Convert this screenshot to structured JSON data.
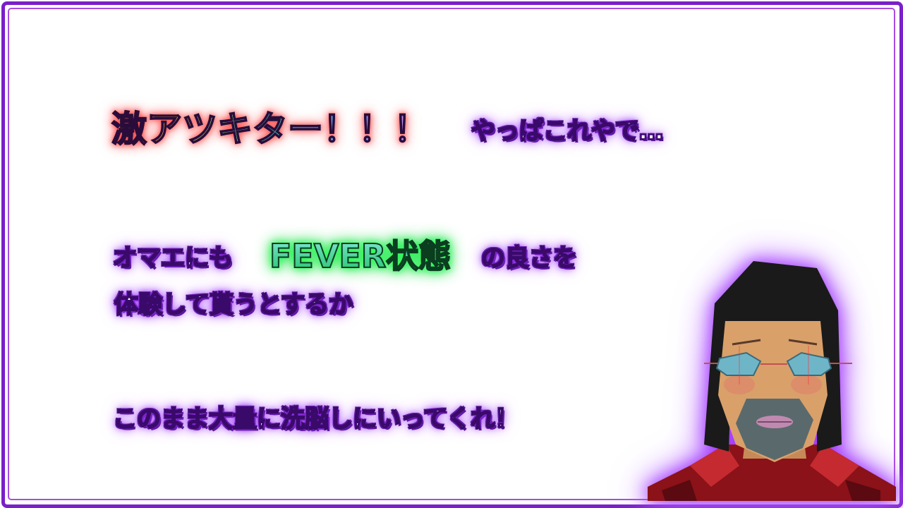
{
  "lines": {
    "l1_big": "激アツキター！！！",
    "l1_small": "やっぱこれやで…",
    "l2_a": "オマエにも",
    "l2_fever": "FEVER状態",
    "l2_b": "の良さを",
    "l3": "体験して貰うとするか",
    "l4": "このまま大量に洗脳しにいってくれ！"
  },
  "colors": {
    "frame": "#7a1fc9",
    "glow": "#9b30ff",
    "fever_glow": "#2cff5a"
  },
  "icons": {
    "character": "3d-bearded-man-character"
  }
}
